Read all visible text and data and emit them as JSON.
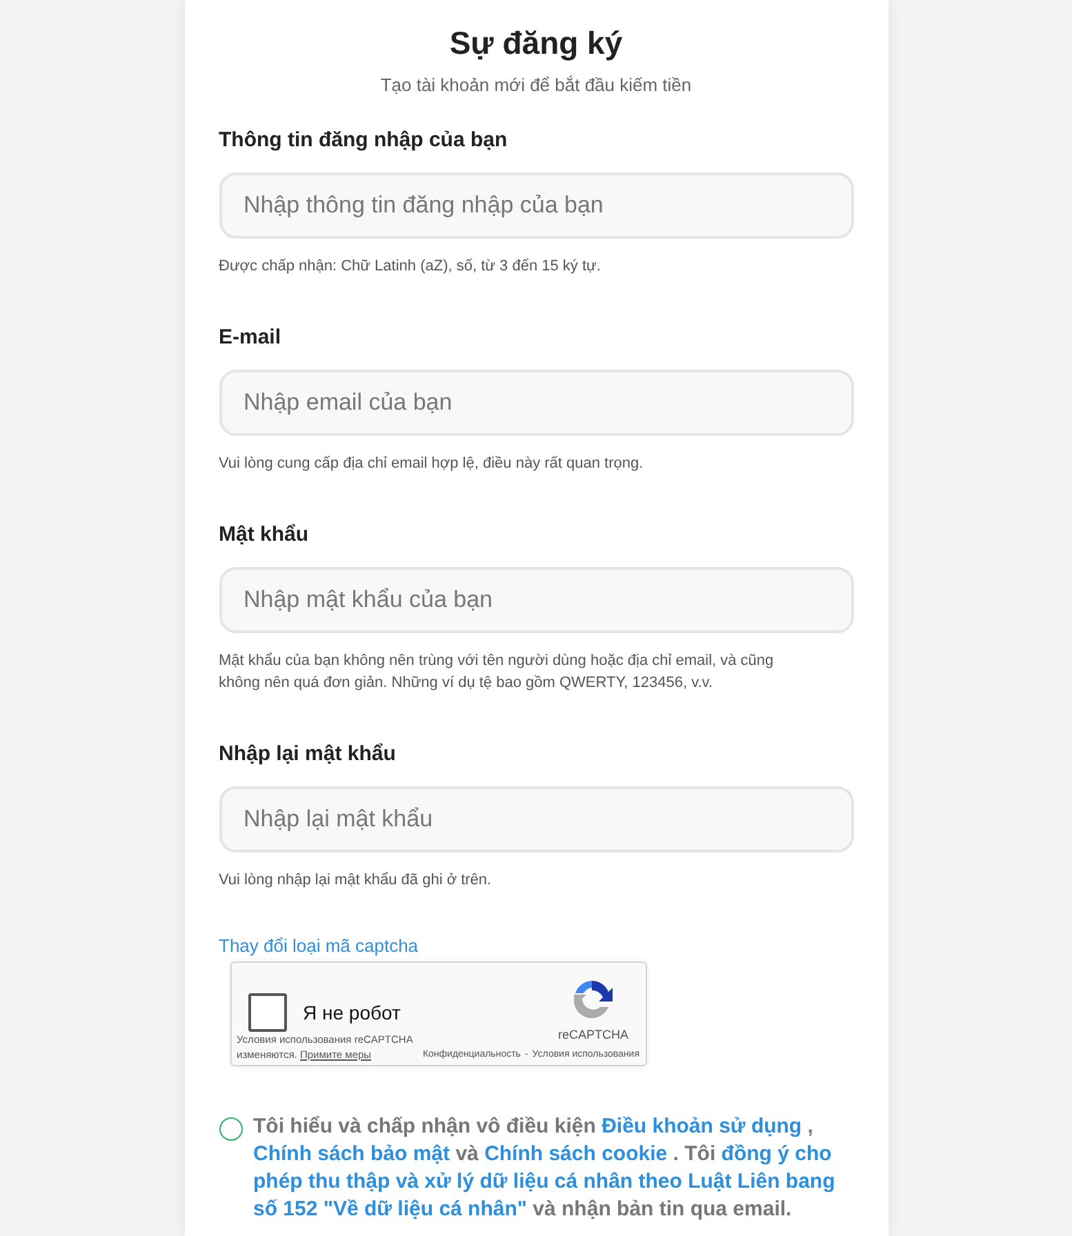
{
  "title": "Sự đăng ký",
  "subtitle": "Tạo tài khoản mới để bắt đầu kiếm tiền",
  "fields": [
    {
      "label": "Thông tin đăng nhập của bạn",
      "placeholder": "Nhập thông tin đăng nhập của bạn",
      "hint": "Được chấp nhận: Chữ Latinh (aZ), số, từ 3 đến 15 ký tự."
    },
    {
      "label": "E-mail",
      "placeholder": "Nhập email của bạn",
      "hint": "Vui lòng cung cấp địa chỉ email hợp lệ, điều này rất quan trọng."
    },
    {
      "label": "Mật khẩu",
      "placeholder": "Nhập mật khẩu của bạn",
      "hint": "Mật khẩu của bạn không nên trùng với tên người dùng hoặc địa chỉ email, và cũng không nên quá đơn giản. Những ví dụ tệ bao gồm QWERTY, 123456, v.v."
    },
    {
      "label": "Nhập lại mật khẩu",
      "placeholder": "Nhập lại mật khẩu",
      "hint": "Vui lòng nhập lại mật khẩu đã ghi ở trên."
    }
  ],
  "captcha_switch": "Thay đổi loại mã captcha",
  "captcha": {
    "checked": false,
    "label": "Я не робот",
    "brand": "reCAPTCHA",
    "notice": "Условия использования reCAPTCHA изменяются.",
    "notice_link": "Примите меры",
    "privacy": "Конфиденциальность",
    "separator": "-",
    "terms": "Условия использования"
  },
  "consent": {
    "checked": false,
    "segments": [
      {
        "text": "Tôi hiểu và chấp nhận vô điều kiện",
        "kind": "text"
      },
      {
        "text": "Điều khoản sử dụng",
        "kind": "link"
      },
      {
        "text": ",",
        "kind": "text"
      },
      {
        "text": "Chính sách bảo mật",
        "kind": "link"
      },
      {
        "text": "và",
        "kind": "text"
      },
      {
        "text": "Chính sách cookie",
        "kind": "link"
      },
      {
        "text": ". Tôi",
        "kind": "text"
      },
      {
        "text": "đồng ý cho",
        "kind": "link"
      },
      {
        "text": "phép thu thập và xử lý dữ liệu cá nhân theo Luật Liên bang",
        "kind": "link"
      },
      {
        "text": "số 152 \"Về dữ liệu cá nhân\"",
        "kind": "link"
      },
      {
        "text": "và nhận bản tin qua email.",
        "kind": "text"
      }
    ]
  }
}
